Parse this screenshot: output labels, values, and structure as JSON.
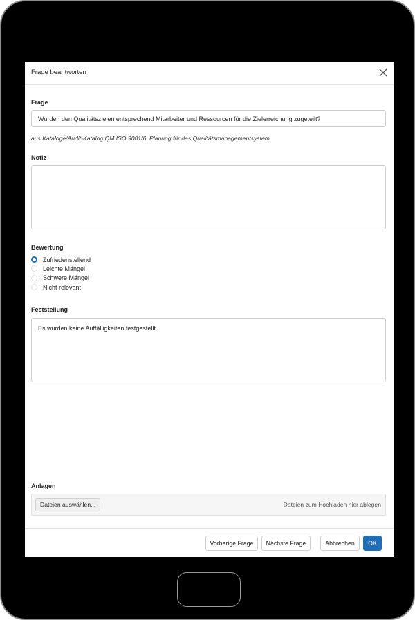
{
  "dialog": {
    "title": "Frage beantworten"
  },
  "question": {
    "label": "Frage",
    "text": "Wurden den Qualitätszielen entsprechend Mitarbeiter und Ressourcen für die Zielerreichung zugeteilt?",
    "source": "aus Kataloge/Audit-Katalog QM ISO 9001/6. Planung für das Qualitätsmanagementsystem"
  },
  "notes": {
    "label": "Notiz",
    "value": ""
  },
  "rating": {
    "label": "Bewertung",
    "options": [
      {
        "label": "Zufriedenstellend",
        "selected": true
      },
      {
        "label": "Leichte Mängel",
        "selected": false
      },
      {
        "label": "Schwere Mängel",
        "selected": false
      },
      {
        "label": "Nicht relevant",
        "selected": false
      }
    ]
  },
  "finding": {
    "label": "Feststellung",
    "value": "Es wurden keine Auffälligkeiten festgestellt."
  },
  "attachments": {
    "label": "Anlagen",
    "choose_button": "Dateien auswählen...",
    "drop_hint": "Dateien zum Hochladen hier ablegen"
  },
  "footer": {
    "prev_label": "Vorherige Frage",
    "next_label": "Nächste Frage",
    "cancel_label": "Abbrechen",
    "ok_label": "OK"
  },
  "colors": {
    "accent": "#1f6fb8",
    "device_frame": "#000000"
  }
}
